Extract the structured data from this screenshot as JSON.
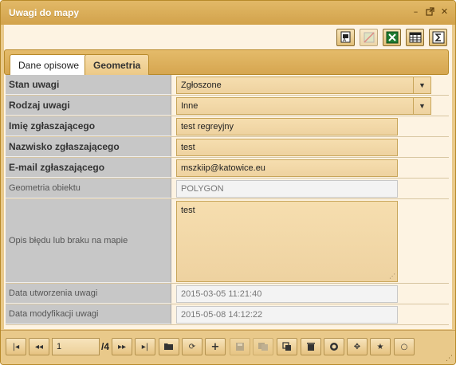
{
  "window": {
    "title": "Uwagi do mapy"
  },
  "toolbar": {
    "buttons": [
      {
        "icon": "print-preview-icon"
      },
      {
        "icon": "map-disabled-icon"
      },
      {
        "icon": "excel-export-icon"
      },
      {
        "icon": "table-icon"
      },
      {
        "icon": "sum-icon"
      }
    ]
  },
  "tabs": [
    {
      "label": "Dane opisowe",
      "active": true
    },
    {
      "label": "Geometria",
      "active": false
    }
  ],
  "form": {
    "stan_uwagi": {
      "label": "Stan uwagi",
      "value": "Zgłoszone"
    },
    "rodzaj_uwagi": {
      "label": "Rodzaj uwagi",
      "value": "Inne"
    },
    "imie": {
      "label": "Imię zgłaszającego",
      "value": "test regreyjny"
    },
    "nazwisko": {
      "label": "Nazwisko zgłaszającego",
      "value": "test"
    },
    "email": {
      "label": "E-mail zgłaszającego",
      "value": "mszkiip@katowice.eu"
    },
    "geometria": {
      "label": "Geometria obiektu",
      "value": "POLYGON"
    },
    "opis": {
      "label": "Opis błędu lub braku na mapie",
      "value": "test"
    },
    "data_utworzenia": {
      "label": "Data utworzenia uwagi",
      "value": "2015-03-05 11:21:40"
    },
    "data_modyfikacji": {
      "label": "Data modyfikacji uwagi",
      "value": "2015-05-08 14:12:22"
    }
  },
  "pager": {
    "current_page": "1",
    "total": "/4"
  },
  "colors": {
    "accent": "#d6a650",
    "title_bar": "#dcae58",
    "field_bg": "#f2d8a6"
  }
}
